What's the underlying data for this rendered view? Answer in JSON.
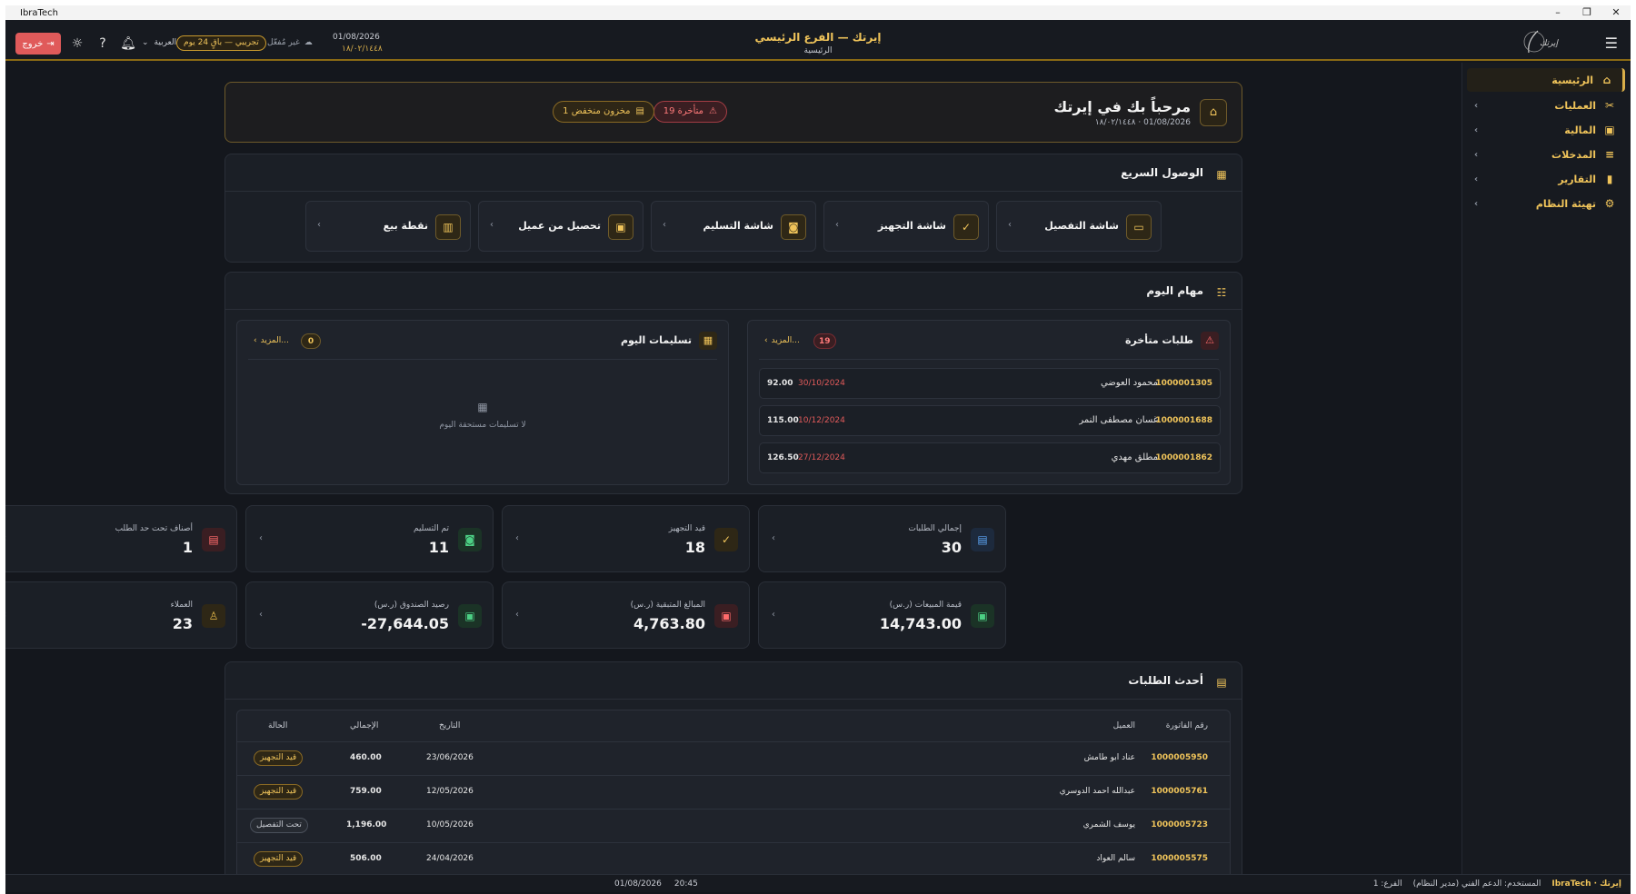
{
  "titlebar": {
    "app_name": "IbraTech",
    "min": "–",
    "restore": "❐",
    "close": "✕"
  },
  "header": {
    "logout_label": "خروج",
    "language": "العربية",
    "trial": "تجريبي — باقٍ 24 يوم",
    "offline": "غير مُفعّل",
    "date_gregorian": "01/08/2026",
    "date_hijri": "١٨/٠٢/١٤٤٨",
    "title": "إيرتك — الفرع الرئيسي",
    "subtitle": "الرئيسية",
    "logo_text": "إيرتك"
  },
  "sidebar": {
    "items": [
      {
        "label": "الرئيسية",
        "icon": "home-icon",
        "active": true
      },
      {
        "label": "العمليات",
        "icon": "scissors-icon"
      },
      {
        "label": "المالية",
        "icon": "money-icon"
      },
      {
        "label": "المدخلات",
        "icon": "list-icon"
      },
      {
        "label": "التقارير",
        "icon": "chart-icon"
      },
      {
        "label": "تهيئة النظام",
        "icon": "gear-icon"
      }
    ]
  },
  "welcome": {
    "title": "مرحباً بك في إيرتك",
    "subtitle": "١٨/٠٢/١٤٤٨ · 01/08/2026",
    "late_badge": "19 متأخرة",
    "low_stock_badge": "1 مخزون منخفض"
  },
  "quick_access": {
    "title": "الوصول السريع",
    "items": [
      {
        "label": "شاشة التفصيل",
        "icon": "card-icon"
      },
      {
        "label": "شاشة التجهيز",
        "icon": "check-circle-icon"
      },
      {
        "label": "شاشة التسليم",
        "icon": "bag-icon"
      },
      {
        "label": "تحصيل من عميل",
        "icon": "cash-icon"
      },
      {
        "label": "نقطة بيع",
        "icon": "register-icon"
      }
    ]
  },
  "tasks": {
    "title": "مهام اليوم",
    "late": {
      "title": "طلبات متأخرة",
      "count": "19",
      "more": "المزيد...",
      "rows": [
        {
          "invoice": "1000001305",
          "customer": "محمود العوضي",
          "date": "30/10/2024",
          "amount": "92.00"
        },
        {
          "invoice": "1000001688",
          "customer": "غسان مصطفى النمر",
          "date": "10/12/2024",
          "amount": "115.00"
        },
        {
          "invoice": "1000001862",
          "customer": "مطلق مهدي",
          "date": "27/12/2024",
          "amount": "126.50"
        }
      ]
    },
    "deliveries": {
      "title": "تسليمات اليوم",
      "count": "0",
      "more": "المزيد...",
      "empty": "لا تسليمات مستحقة اليوم"
    }
  },
  "stats": [
    {
      "label": "إجمالي الطلبات",
      "value": "30",
      "icon": "receipt-icon",
      "tone": "blue"
    },
    {
      "label": "قيد التجهيز",
      "value": "18",
      "icon": "check-circle-icon",
      "tone": "amber"
    },
    {
      "label": "تم التسليم",
      "value": "11",
      "icon": "bag-icon",
      "tone": "green"
    },
    {
      "label": "أصناف تحت حد الطلب",
      "value": "1",
      "icon": "box-icon",
      "tone": "red"
    },
    {
      "label": "قيمة المبيعات (ر.س)",
      "value": "14,743.00",
      "icon": "cash-icon",
      "tone": "green"
    },
    {
      "label": "المبالغ المتبقية (ر.س)",
      "value": "4,763.80",
      "icon": "cash-icon",
      "tone": "red"
    },
    {
      "label": "رصيد الصندوق (ر.س)",
      "value": "-27,644.05",
      "icon": "cash-icon",
      "tone": "green"
    },
    {
      "label": "العملاء",
      "value": "23",
      "icon": "user-icon",
      "tone": "gold"
    }
  ],
  "recent_orders": {
    "title": "أحدث الطلبات",
    "columns": {
      "invoice": "رقم الفاتورة",
      "customer": "العميل",
      "date": "التاريخ",
      "total": "الإجمالي",
      "status": "الحالة"
    },
    "rows": [
      {
        "invoice": "1000005950",
        "customer": "عناد ابو طامش",
        "date": "23/06/2026",
        "total": "460.00",
        "status": "قيد التجهيز",
        "status_type": "prep"
      },
      {
        "invoice": "1000005761",
        "customer": "عبدالله احمد الدوسري",
        "date": "12/05/2026",
        "total": "759.00",
        "status": "قيد التجهيز",
        "status_type": "prep"
      },
      {
        "invoice": "1000005723",
        "customer": "يوسف الشمري",
        "date": "10/05/2026",
        "total": "1,196.00",
        "status": "تحت التفصيل",
        "status_type": "detail"
      },
      {
        "invoice": "1000005575",
        "customer": "سالم العواد",
        "date": "24/04/2026",
        "total": "506.00",
        "status": "قيد التجهيز",
        "status_type": "prep"
      }
    ]
  },
  "statusbar": {
    "date": "01/08/2026",
    "time": "20:45",
    "brand": "IbraTech · إيرتك",
    "user": "المستخدم: الدعم الفني (مدير النظام)",
    "branch": "الفرع: 1"
  },
  "colors": {
    "accent": "#f0c45a",
    "danger": "#e05a5a",
    "background": "#14171d",
    "card": "#1b1f26"
  }
}
